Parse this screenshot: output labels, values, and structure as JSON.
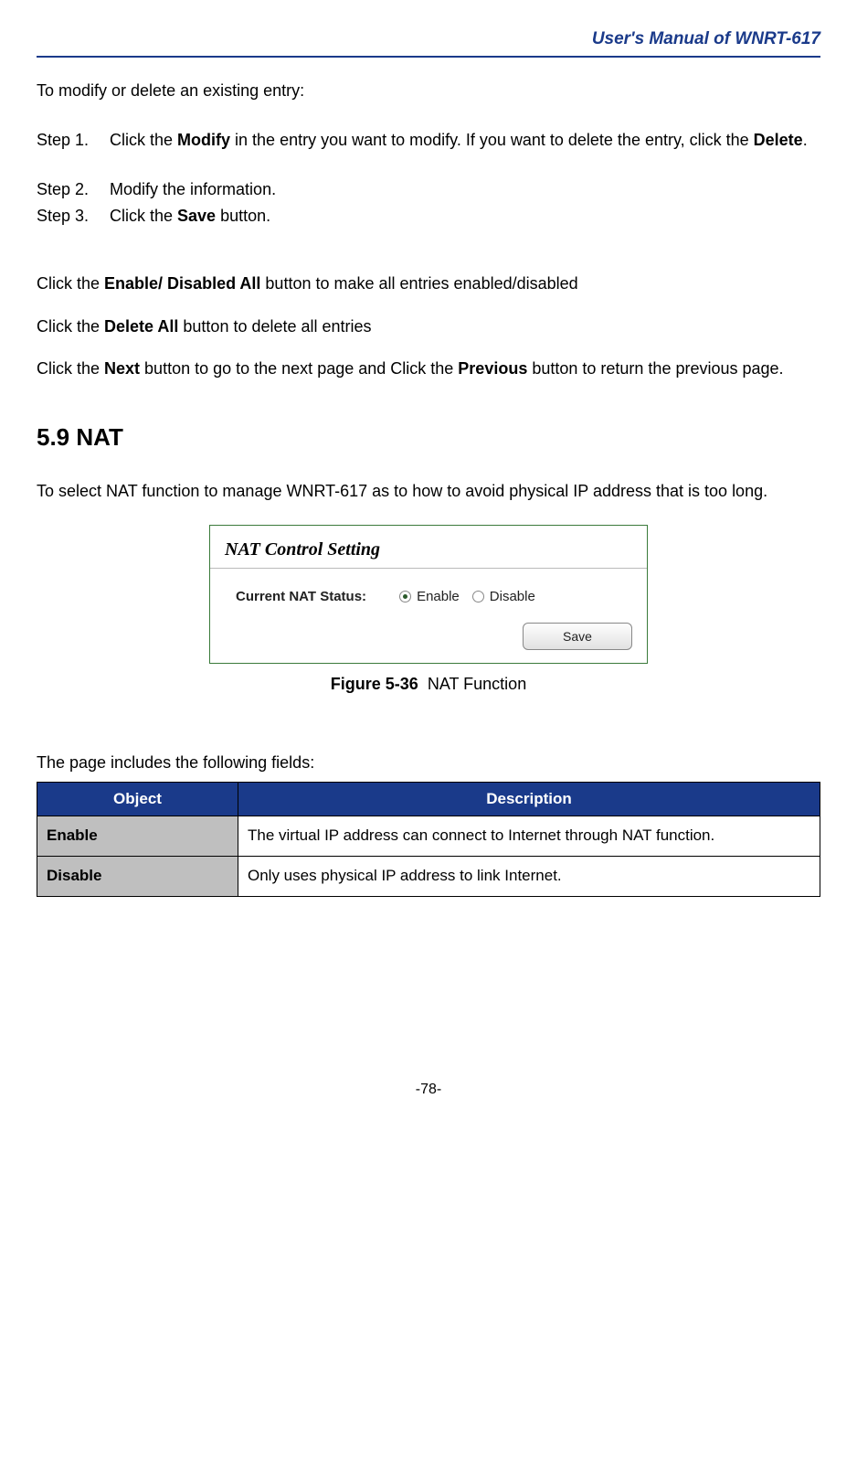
{
  "header": {
    "title": "User's Manual of WNRT-617"
  },
  "intro": "To modify or delete an existing entry:",
  "steps": [
    {
      "label": "Step 1.",
      "pre": "Click the ",
      "bold1": "Modify",
      "mid": " in the entry you want to modify. If you want to delete the entry, click the ",
      "bold2": "Delete",
      "post": "."
    },
    {
      "label": "Step 2.",
      "pre": "Modify the information.",
      "bold1": "",
      "mid": "",
      "bold2": "",
      "post": ""
    },
    {
      "label": "Step 3.",
      "pre": "Click the ",
      "bold1": "Save",
      "mid": " button.",
      "bold2": "",
      "post": ""
    }
  ],
  "notes": {
    "enable_all": {
      "pre": "Click the ",
      "bold": "Enable/ Disabled All",
      "post": " button to make all entries enabled/disabled"
    },
    "delete_all": {
      "pre": "Click the ",
      "bold": "Delete All",
      "post": " button to delete all entries"
    },
    "pagination": {
      "pre": "Click the ",
      "bold1": "Next",
      "mid": " button to go to the next page and Click the ",
      "bold2": "Previous",
      "post": " button to return the previous page."
    }
  },
  "section": {
    "heading": "5.9  NAT",
    "description": "To select NAT function to manage WNRT-617 as to how to avoid physical IP address that is too long."
  },
  "panel": {
    "title": "NAT Control Setting",
    "status_label": "Current NAT Status:",
    "enable_label": "Enable",
    "disable_label": "Disable",
    "save_label": "Save",
    "selected": "enable"
  },
  "figure": {
    "label": "Figure 5-36",
    "caption": "NAT Function"
  },
  "fields_intro": "The page includes the following fields:",
  "table": {
    "headers": {
      "object": "Object",
      "description": "Description"
    },
    "rows": [
      {
        "object": "Enable",
        "description": "The virtual IP address can connect to Internet through NAT function."
      },
      {
        "object": "Disable",
        "description": "Only uses physical IP address to link Internet."
      }
    ]
  },
  "page_number": "-78-"
}
